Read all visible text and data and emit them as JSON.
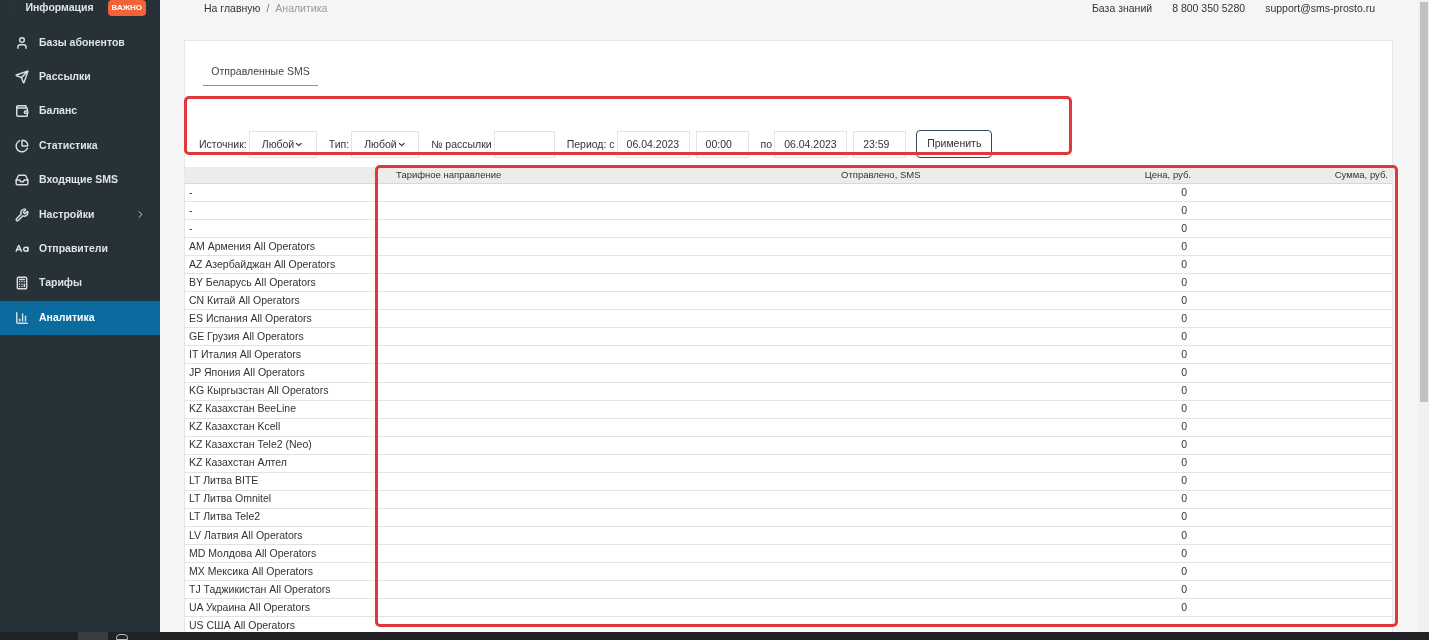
{
  "sidebar": {
    "items": [
      {
        "label": "Информация",
        "badge": "ВАЖНО",
        "selected": false
      },
      {
        "label": "Базы абонентов",
        "selected": false
      },
      {
        "label": "Рассылки",
        "selected": false
      },
      {
        "label": "Баланс",
        "selected": false
      },
      {
        "label": "Статистика",
        "selected": false
      },
      {
        "label": "Входящие SMS",
        "selected": false
      },
      {
        "label": "Настройки",
        "submenu": true,
        "selected": false
      },
      {
        "label": "Отправители",
        "selected": false
      },
      {
        "label": "Тарифы",
        "selected": false
      },
      {
        "label": "Аналитика",
        "selected": true
      }
    ]
  },
  "breadcrumbs": [
    {
      "label": "На главную",
      "selected": false
    },
    {
      "label": "Аналитика",
      "selected": true
    }
  ],
  "breadcrumb_separator": "/",
  "header_links": [
    "База знаний",
    "8 800 350 5280",
    "support@sms-prosto.ru"
  ],
  "tabs": [
    {
      "label": "Отправленные SMS",
      "selected": true
    }
  ],
  "filters": {
    "highlighted": true,
    "fields": [
      {
        "kind": "select",
        "label": "Источник:",
        "value": "Любой"
      },
      {
        "kind": "select",
        "label": "Тип:",
        "value": "Любой"
      },
      {
        "kind": "text",
        "label": "№ рассылки"
      },
      {
        "kind": "date",
        "label": "Период: с",
        "value": "06.04.2023"
      },
      {
        "kind": "time",
        "value": "00:00"
      },
      {
        "kind": "date",
        "label": "по",
        "value": "06.04.2023"
      },
      {
        "kind": "time",
        "value": "23:59"
      }
    ],
    "apply_button": "Применить"
  },
  "table": {
    "highlighted": true,
    "columns": [
      "Тарифное направление",
      "Отправлено, SMS",
      "Цена, руб.",
      "Сумма, руб."
    ],
    "rows": [
      {
        "name": "-",
        "price": "0"
      },
      {
        "name": "-",
        "price": "0"
      },
      {
        "name": "-",
        "price": "0"
      },
      {
        "name": "AM Армения All Operators",
        "price": "0"
      },
      {
        "name": "AZ Азербайджан All Operators",
        "price": "0"
      },
      {
        "name": "BY Беларусь All Operators",
        "price": "0"
      },
      {
        "name": "CN Китай All Operators",
        "price": "0"
      },
      {
        "name": "ES Испания All Operators",
        "price": "0"
      },
      {
        "name": "GE Грузия All Operators",
        "price": "0"
      },
      {
        "name": "IT Италия All Operators",
        "price": "0"
      },
      {
        "name": "JP Япония All Operators",
        "price": "0"
      },
      {
        "name": "KG Кыргызстан All Operators",
        "price": "0"
      },
      {
        "name": "KZ Казахстан BeeLine",
        "price": "0"
      },
      {
        "name": "KZ Казахстан Kcell",
        "price": "0"
      },
      {
        "name": "KZ Казахстан Tele2 (Neo)",
        "price": "0"
      },
      {
        "name": "KZ Казахстан Алтел",
        "price": "0"
      },
      {
        "name": "LT Литва BITE",
        "price": "0"
      },
      {
        "name": "LT Литва Omnitel",
        "price": "0"
      },
      {
        "name": "LT Литва Tele2",
        "price": "0"
      },
      {
        "name": "LV Латвия All Operators",
        "price": "0"
      },
      {
        "name": "MD Молдова All Operators",
        "price": "0"
      },
      {
        "name": "MX Мексика All Operators",
        "price": "0"
      },
      {
        "name": "TJ Таджикистан All Operators",
        "price": "0"
      },
      {
        "name": "UA Украина All Operators",
        "price": "0"
      },
      {
        "name": "US США All Operators"
      }
    ]
  }
}
